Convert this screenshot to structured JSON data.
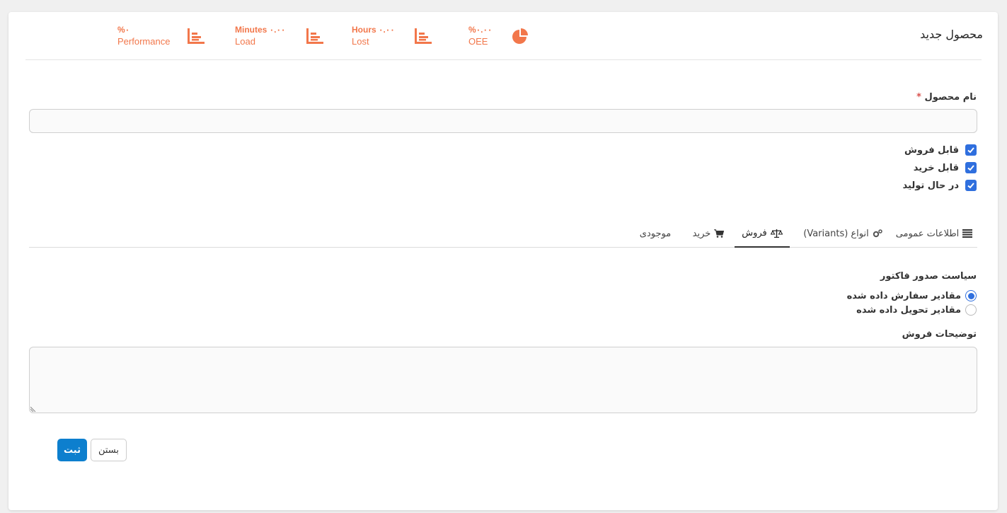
{
  "page": {
    "title": "محصول جدید"
  },
  "stats": [
    {
      "value": "%۰.۰۰",
      "label": "OEE",
      "icon": "pie-chart-icon"
    },
    {
      "value": "Hours ۰.۰۰",
      "label": "Lost",
      "icon": "bar-chart-icon"
    },
    {
      "value": "Minutes ۰.۰۰",
      "label": "Load",
      "icon": "bar-chart-icon"
    },
    {
      "value": "%۰",
      "label": "Performance",
      "icon": "bar-chart-icon"
    }
  ],
  "colors": {
    "accent": "#f2774b",
    "primary": "#0d7fce",
    "check": "#2f6fde"
  },
  "form": {
    "name_label": "نام محصول",
    "required_mark": "*",
    "name_value": "",
    "checks": [
      {
        "label": "قابل فروش",
        "checked": true
      },
      {
        "label": "قابل خرید",
        "checked": true
      },
      {
        "label": "در حال تولید",
        "checked": true
      }
    ]
  },
  "tabs": [
    {
      "label": "اطلاعات عمومی",
      "icon": "list-icon"
    },
    {
      "label": "انواع (Variants)",
      "icon": "gears-icon"
    },
    {
      "label": "فروش",
      "icon": "balance-scale-icon",
      "active": true
    },
    {
      "label": "خرید",
      "icon": "shopping-cart-icon"
    },
    {
      "label": "موجودی",
      "icon": ""
    }
  ],
  "sales": {
    "policy_label": "سیاست صدور فاکتور",
    "options": [
      {
        "label": "مقادیر سفارش داده شده",
        "selected": true
      },
      {
        "label": "مقادیر تحویل داده شده",
        "selected": false
      }
    ],
    "description_label": "توضیحات فروش",
    "description_value": ""
  },
  "buttons": {
    "submit": "ثبت",
    "close": "بستن"
  }
}
